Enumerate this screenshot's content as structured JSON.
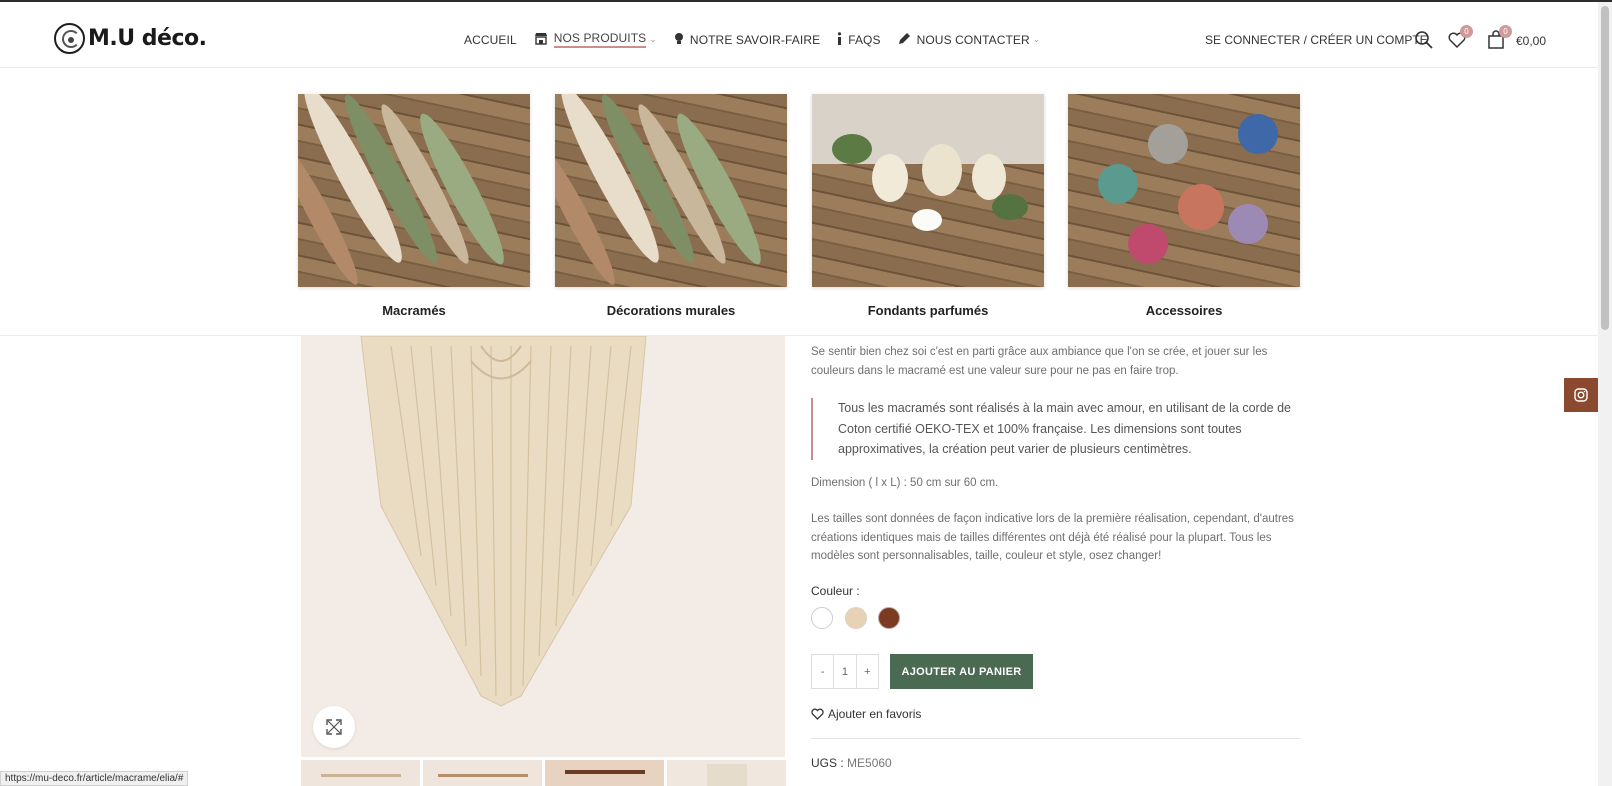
{
  "brand": {
    "logo_text": "M.U déco."
  },
  "nav": {
    "items": [
      {
        "label": "ACCUEIL"
      },
      {
        "label": "NOS PRODUITS"
      },
      {
        "label": "NOTRE SAVOIR-FAIRE"
      },
      {
        "label": "FAQS"
      },
      {
        "label": "NOUS CONTACTER"
      }
    ],
    "account": "SE CONNECTER / CRÉER UN COMPTE",
    "wishlist_count": "0",
    "cart_count": "0",
    "cart_total": "€0,00"
  },
  "mega_menu": {
    "categories": [
      {
        "name": "Macramés"
      },
      {
        "name": "Décorations murales"
      },
      {
        "name": "Fondants parfumés"
      },
      {
        "name": "Accessoires"
      }
    ]
  },
  "product": {
    "desc_partial": "Se sentir bien chez soi c'est en parti grâce aux ambiance que l'on se crée, et jouer sur les couleurs dans le macramé est une valeur sure pour ne pas en faire trop.",
    "quote": "Tous les macramés sont réalisés à la main avec amour, en utilisant de la corde de Coton certifié OEKO-TEX et 100% française. Les dimensions sont toutes approximatives, la création peut varier de plusieurs centimètres.",
    "dimension": "Dimension ( l x L) : 50 cm sur 60 cm.",
    "sizes_note": "Les tailles sont données de façon indicative lors de la première réalisation, cependant, d'autres créations identiques mais de tailles différentes ont déjà été réalisé pour la plupart. Tous les modèles sont personnalisables, taille, couleur et style, osez changer!",
    "color_label": "Couleur",
    "swatch_colors": [
      "#ffffff",
      "#e8d2b6",
      "#7c3a22"
    ],
    "qty_minus": "-",
    "qty_value": "1",
    "qty_plus": "+",
    "add_to_cart": "AJOUTER AU PANIER",
    "add_favorite": "Ajouter en favoris",
    "sku_label": "UGS :",
    "sku_value": "ME5060"
  },
  "status_url": "https://mu-deco.fr/article/macrame/elia/#",
  "colors": {
    "accent_green": "#4a6a52",
    "accent_rose": "#c98f8f",
    "instagram_bg": "#8b4a2f"
  }
}
